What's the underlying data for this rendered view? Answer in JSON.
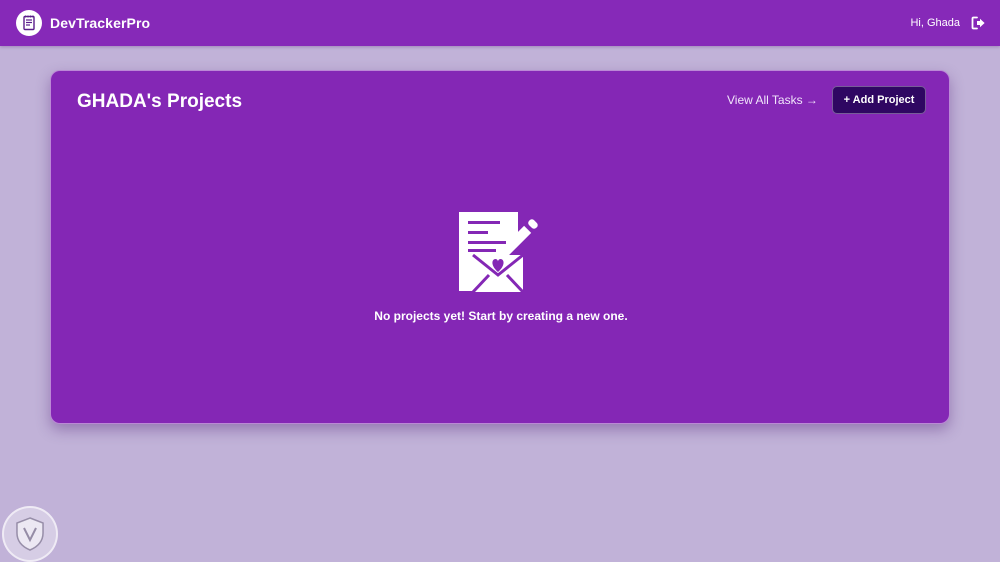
{
  "navbar": {
    "brand_name": "DevTrackerPro",
    "logo_icon": "notepad-icon",
    "greeting": "Hi, Ghada",
    "logout_icon": "logout-icon",
    "background_color": "#8629b8"
  },
  "projects": {
    "title": "GHADA's Projects",
    "view_all_label": "View All Tasks →",
    "add_button_label": "+ Add Project",
    "empty_icon": "document-envelope-heart-icon",
    "empty_message": "No projects yet! Start by creating a new one.",
    "card_color": "#8427b5",
    "button_color": "#2f0762"
  },
  "page": {
    "background_color": "#c1b2d8",
    "watermark_icon": "shield-logo-icon"
  }
}
